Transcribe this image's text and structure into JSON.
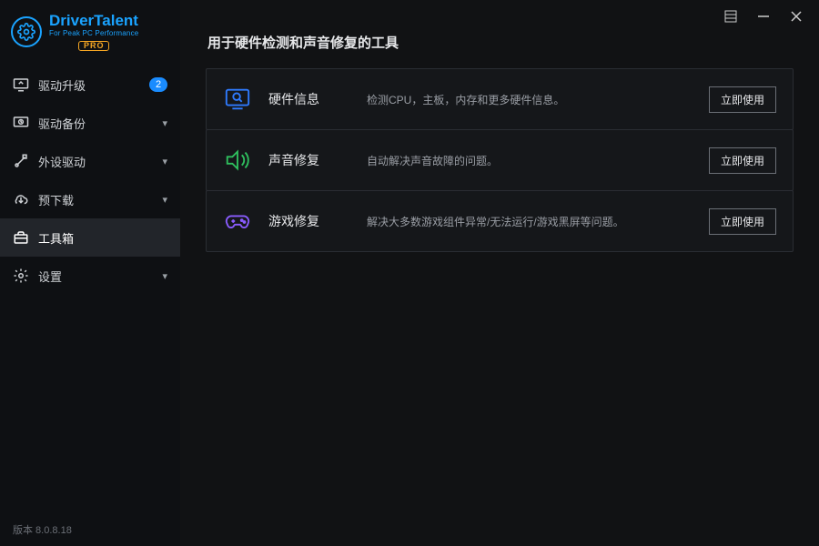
{
  "brand": {
    "word1": "Driver",
    "word2": "Talent",
    "sub": "For Peak PC Performance",
    "pro": "PRO"
  },
  "sidebar": {
    "items": [
      {
        "label": "驱动升级",
        "badge": "2",
        "has_chevron": false
      },
      {
        "label": "驱动备份",
        "badge": null,
        "has_chevron": true
      },
      {
        "label": "外设驱动",
        "badge": null,
        "has_chevron": true
      },
      {
        "label": "预下载",
        "badge": null,
        "has_chevron": true
      },
      {
        "label": "工具箱",
        "badge": null,
        "has_chevron": false
      },
      {
        "label": "设置",
        "badge": null,
        "has_chevron": true
      }
    ],
    "active_index": 4
  },
  "footer": {
    "version": "版本 8.0.8.18"
  },
  "main": {
    "title": "用于硬件检测和声音修复的工具",
    "button_label": "立即使用",
    "tools": [
      {
        "name": "硬件信息",
        "desc": "检测CPU，主板，内存和更多硬件信息。",
        "icon_color": "#2f7bff"
      },
      {
        "name": "声音修复",
        "desc": "自动解决声音故障的问题。",
        "icon_color": "#2fbf5e"
      },
      {
        "name": "游戏修复",
        "desc": "解决大多数游戏组件异常/无法运行/游戏黑屏等问题。",
        "icon_color": "#8a5cff"
      }
    ]
  }
}
